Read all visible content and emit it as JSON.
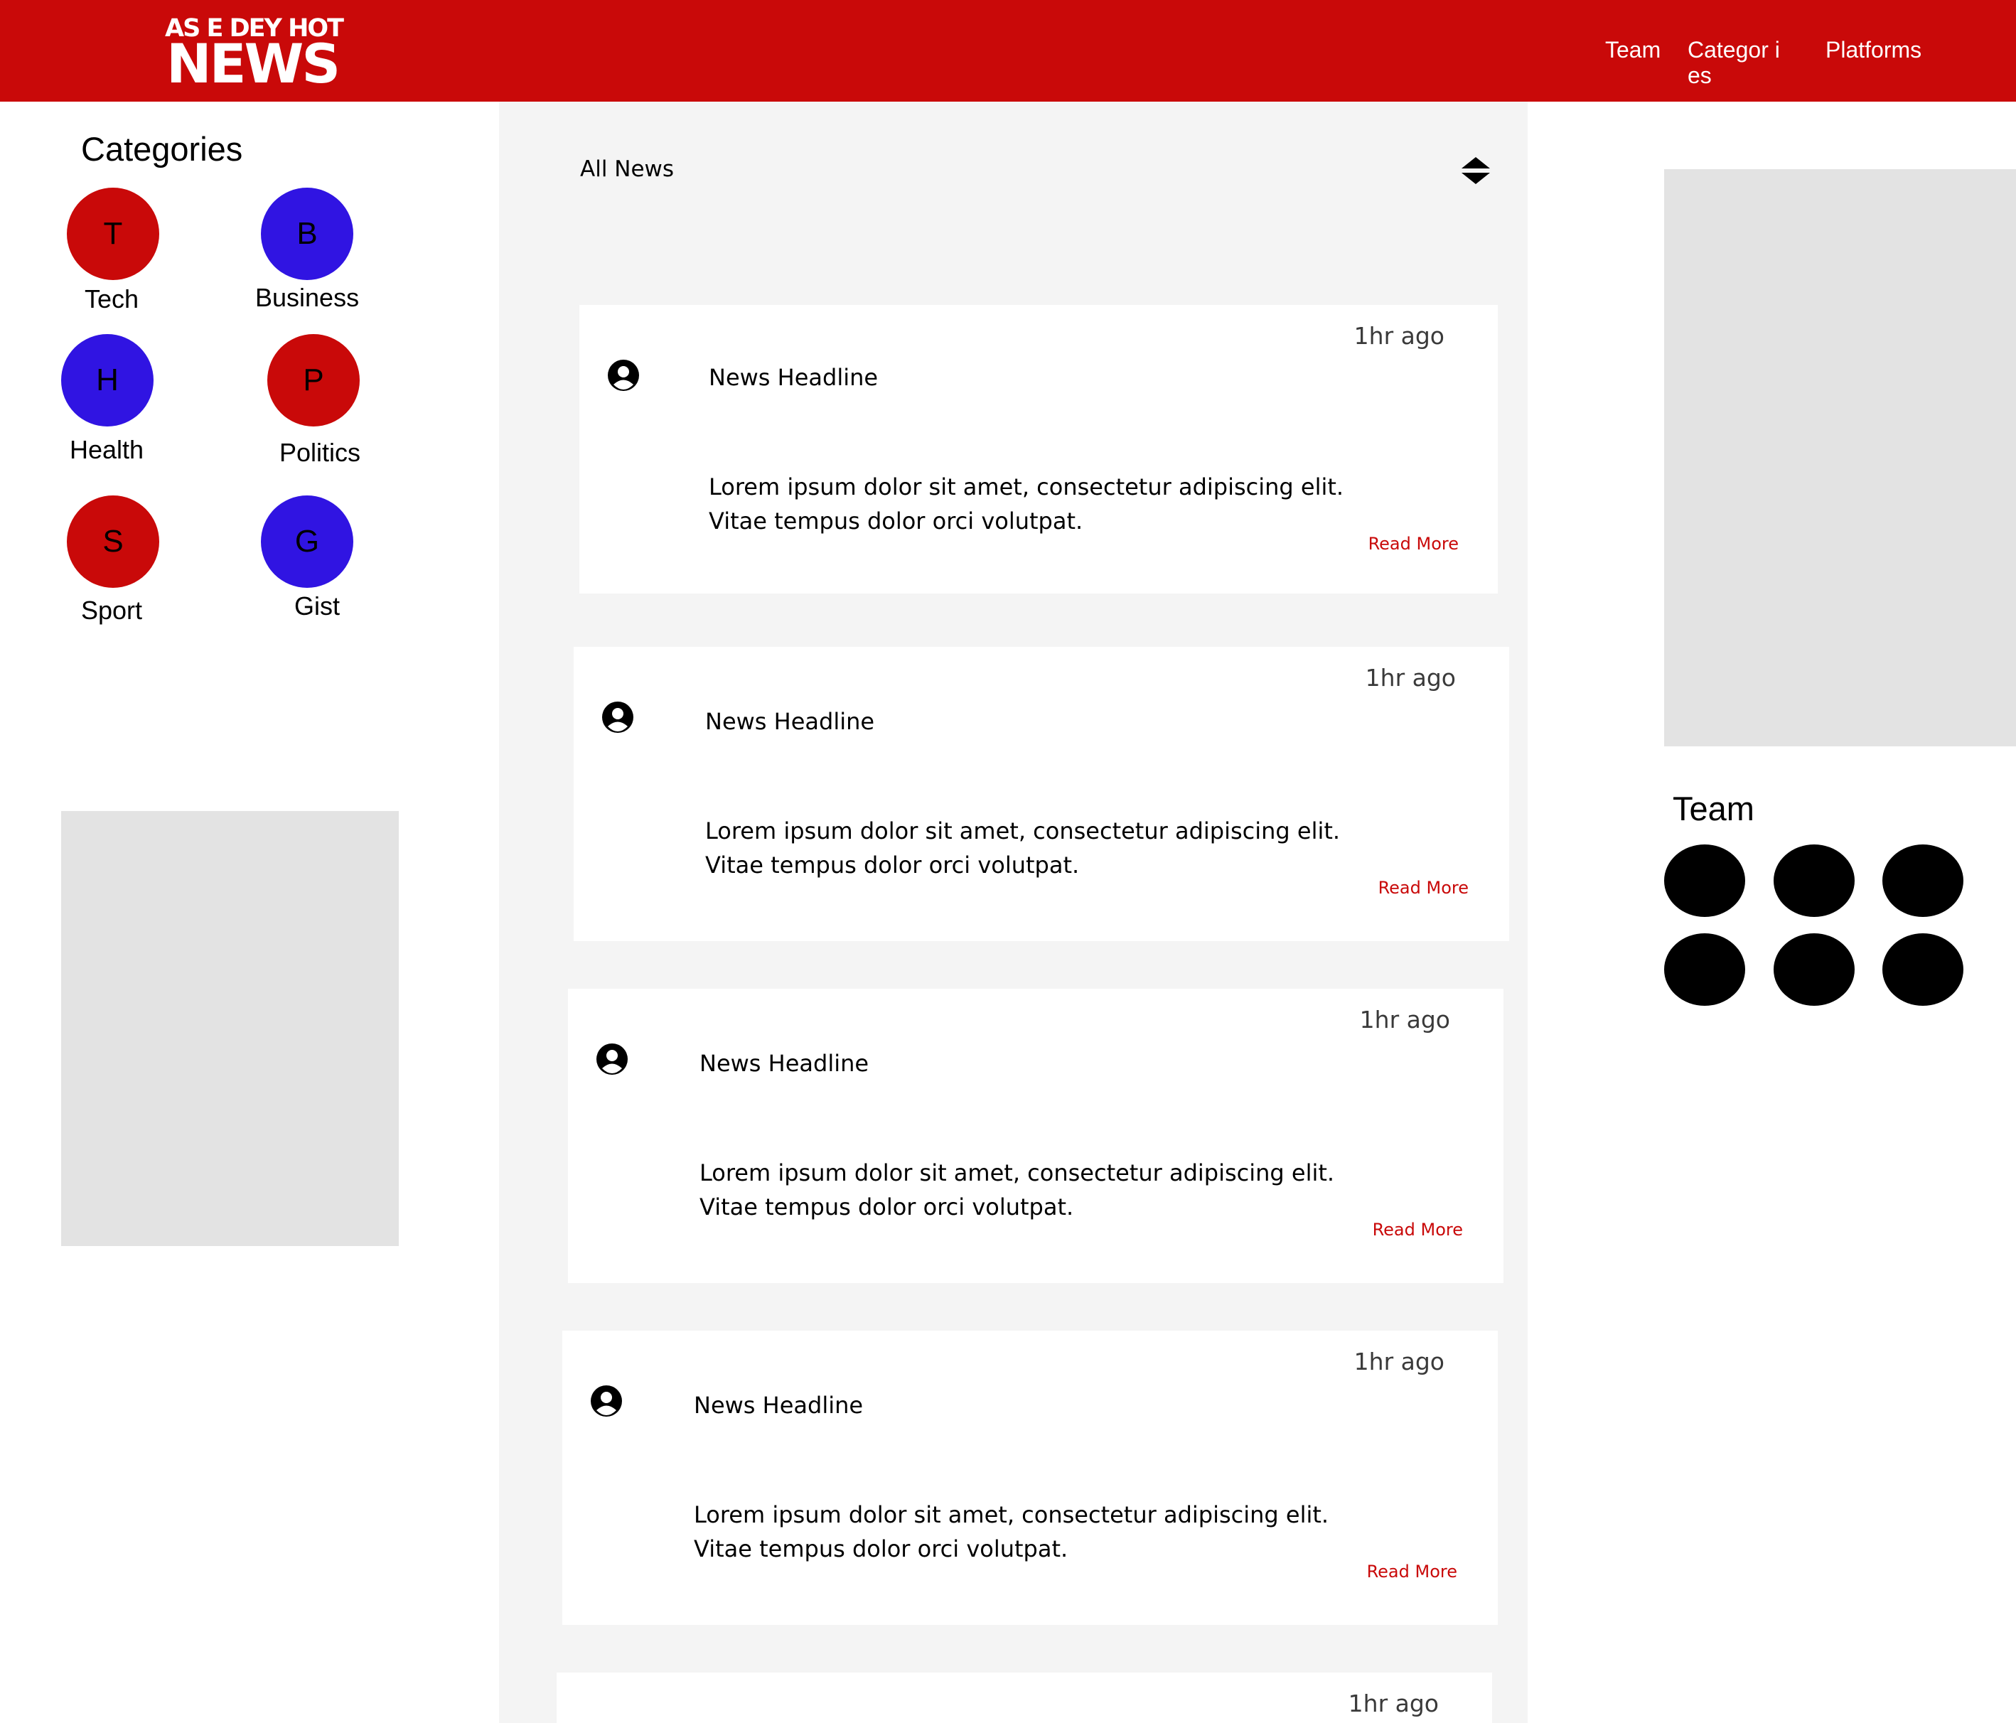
{
  "brand": {
    "top_line": "AS E DEY HOT",
    "main_line": "NEWS",
    "color": "#c90909"
  },
  "nav": {
    "items": [
      {
        "label": "Team"
      },
      {
        "label": "Categor ies"
      },
      {
        "label": "Platforms"
      }
    ]
  },
  "categories": {
    "title": "Categories",
    "items": [
      {
        "initial": "T",
        "label": "Tech",
        "color": "#c90909"
      },
      {
        "initial": "B",
        "label": "Business",
        "color": "#3014e2"
      },
      {
        "initial": "H",
        "label": "Health",
        "color": "#3014e2"
      },
      {
        "initial": "P",
        "label": "Politics",
        "color": "#c90909"
      },
      {
        "initial": "S",
        "label": "Sport",
        "color": "#c90909"
      },
      {
        "initial": "G",
        "label": "Gist",
        "color": "#3014e2"
      }
    ]
  },
  "feed": {
    "filter_label": "All News",
    "sort_icon": "sort-icon",
    "cards": [
      {
        "time": "1hr ago",
        "headline": "News Headline",
        "body_line1": "Lorem ipsum dolor sit amet, consectetur adipiscing elit.",
        "body_line2": "Vitae tempus dolor orci volutpat.",
        "read_more": "Read More"
      },
      {
        "time": "1hr ago",
        "headline": "News Headline",
        "body_line1": "Lorem ipsum dolor sit amet, consectetur adipiscing elit.",
        "body_line2": "Vitae tempus dolor orci volutpat.",
        "read_more": "Read More"
      },
      {
        "time": "1hr ago",
        "headline": "News Headline",
        "body_line1": "Lorem ipsum dolor sit amet, consectetur adipiscing elit.",
        "body_line2": "Vitae tempus dolor orci volutpat.",
        "read_more": "Read More"
      },
      {
        "time": "1hr ago",
        "headline": "News Headline",
        "body_line1": "Lorem ipsum dolor sit amet, consectetur adipiscing elit.",
        "body_line2": "Vitae tempus dolor orci volutpat.",
        "read_more": "Read More"
      },
      {
        "time": "1hr ago"
      }
    ]
  },
  "team": {
    "title": "Team",
    "member_count": 6
  }
}
